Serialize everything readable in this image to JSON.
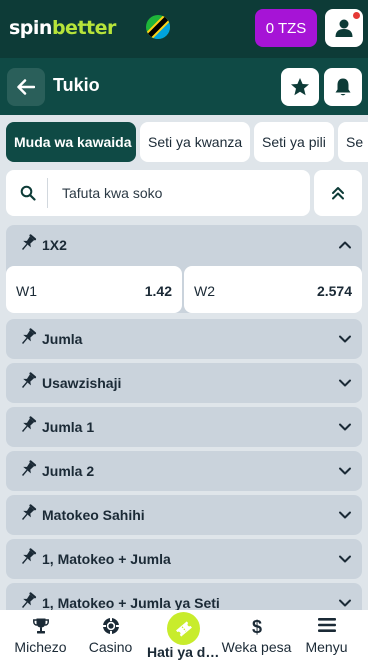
{
  "header": {
    "logo_left": "spin",
    "logo_right": "better",
    "balance": "0 TZS",
    "colors": {
      "bg": "#0d3b37",
      "balance_bg": "#a614d6",
      "logo_accent": "#b7e43a"
    }
  },
  "subheader": {
    "title": "Tukio"
  },
  "tabs": [
    {
      "label": "Muda wa kawaida",
      "active": true
    },
    {
      "label": "Seti ya kwanza"
    },
    {
      "label": "Seti ya pili"
    },
    {
      "label": "Se"
    }
  ],
  "search": {
    "placeholder": "Tafuta kwa soko"
  },
  "markets": [
    {
      "name": "1X2",
      "expanded": true,
      "odds": [
        {
          "label": "W1",
          "value": "1.42"
        },
        {
          "label": "W2",
          "value": "2.574"
        }
      ]
    },
    {
      "name": "Jumla"
    },
    {
      "name": "Usawzishaji"
    },
    {
      "name": "Jumla 1"
    },
    {
      "name": "Jumla 2"
    },
    {
      "name": "Matokeo Sahihi"
    },
    {
      "name": "1, Matokeo + Jumla"
    },
    {
      "name": "1, Matokeo + Jumla ya Seti"
    }
  ],
  "bottom_nav": [
    {
      "label": "Michezo",
      "icon": "trophy-icon"
    },
    {
      "label": "Casino",
      "icon": "poker-chip-icon"
    },
    {
      "label": "Hati ya dau",
      "icon": "ticket-icon",
      "active": true
    },
    {
      "label": "Weka pesa",
      "icon": "dollar-icon"
    },
    {
      "label": "Menyu",
      "icon": "menu-icon"
    }
  ]
}
